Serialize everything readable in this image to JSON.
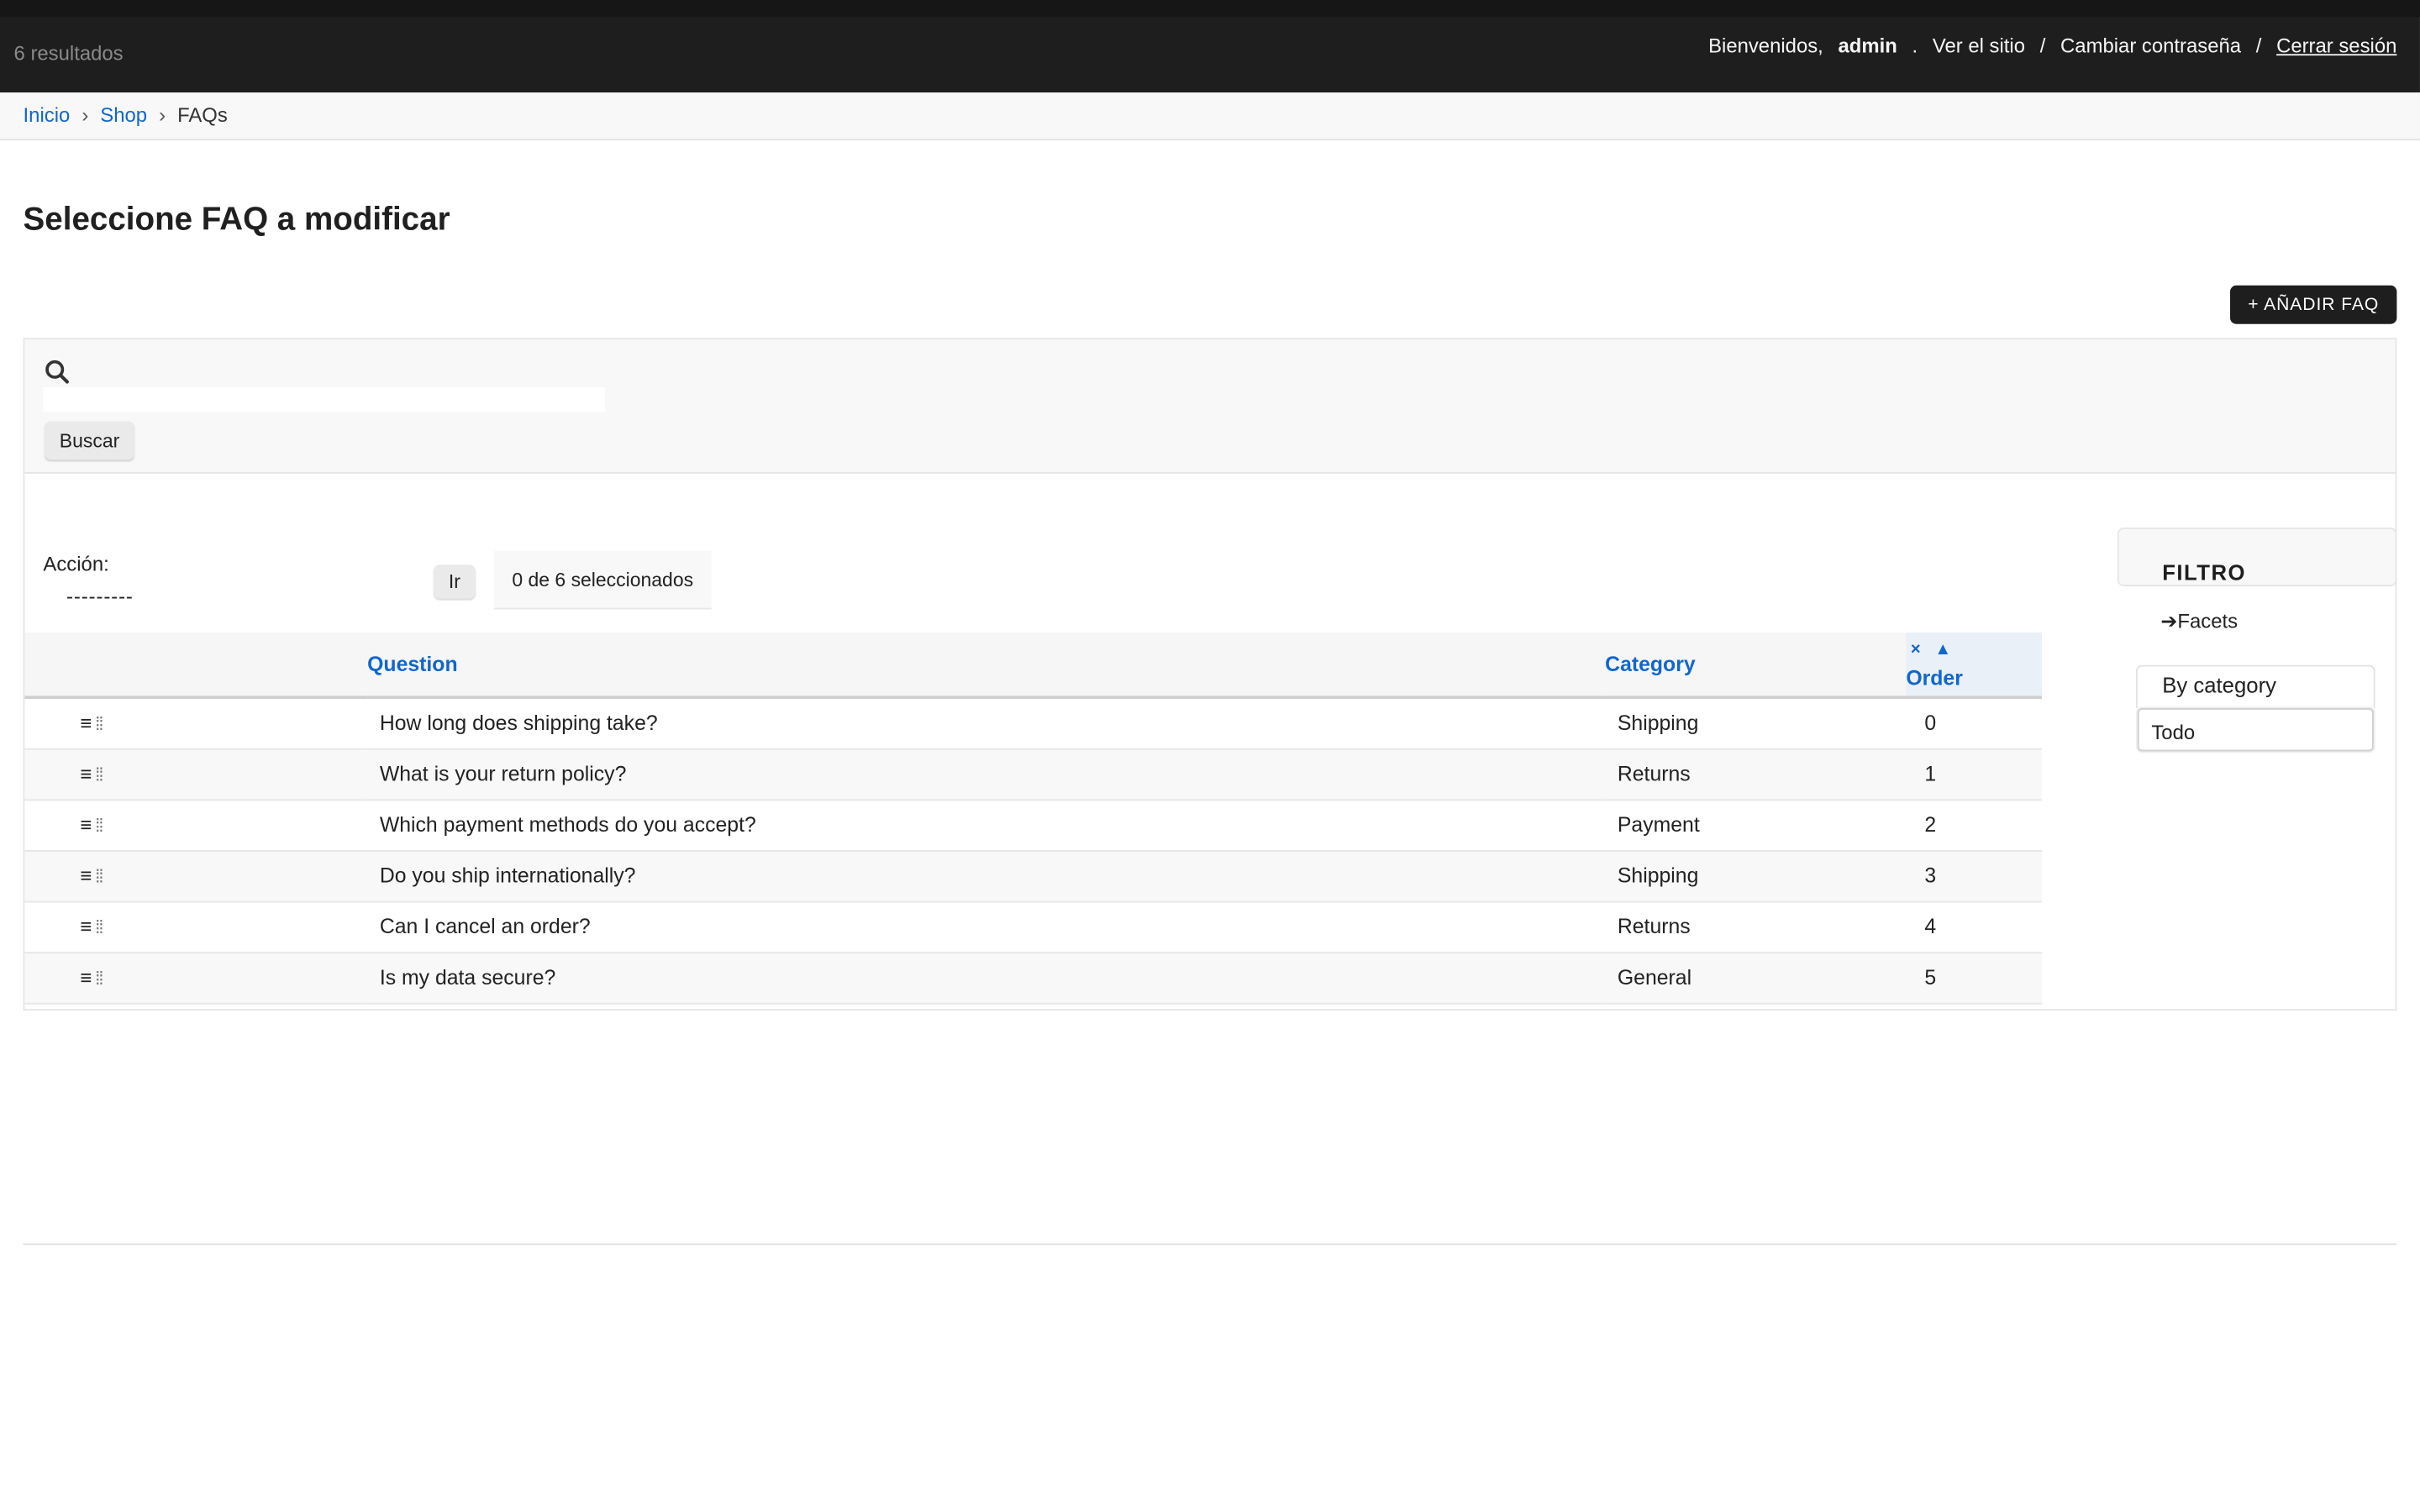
{
  "header": {
    "results_count": "6 resultados",
    "welcome": "Bienvenidos,",
    "username": "admin",
    "dot": ".",
    "view_site": "Ver el sitio",
    "change_password": "Cambiar contraseña",
    "logout": "Cerrar sesión",
    "separator": "/"
  },
  "breadcrumbs": {
    "home": "Inicio",
    "app": "Shop",
    "current": "FAQs",
    "separator": "›"
  },
  "page_title": "Seleccione FAQ a modificar",
  "add_button": "+ AÑADIR FAQ",
  "search": {
    "icon": "search-icon",
    "button": "Buscar",
    "value": ""
  },
  "actions": {
    "label": "Acción:",
    "selected_option": "---------",
    "go_button": "Ir",
    "selection_counter": "0 de 6 seleccionados"
  },
  "table": {
    "columns": {
      "question": "Question",
      "category": "Category",
      "order": "Order"
    },
    "sort_remove": "×",
    "sort_toggle": "▲",
    "rows": [
      {
        "handle": "≡",
        "question": "How long does shipping take?",
        "category": "Shipping",
        "order": "0"
      },
      {
        "handle": "≡",
        "question": "What is your return policy?",
        "category": "Returns",
        "order": "1"
      },
      {
        "handle": "≡",
        "question": "Which payment methods do you accept?",
        "category": "Payment",
        "order": "2"
      },
      {
        "handle": "≡",
        "question": "Do you ship internationally?",
        "category": "Shipping",
        "order": "3"
      },
      {
        "handle": "≡",
        "question": "Can I cancel an order?",
        "category": "Returns",
        "order": "4"
      },
      {
        "handle": "≡",
        "question": "Is my data secure?",
        "category": "General",
        "order": "5"
      }
    ]
  },
  "filter": {
    "title": "FILTRO",
    "facets": "➔Facets",
    "by_category": "By category",
    "selected": "Todo"
  },
  "colors": {
    "header_bg": "#1e1e1e",
    "link": "#1266cc",
    "sorted_header_bg": "#e9f0f8"
  }
}
